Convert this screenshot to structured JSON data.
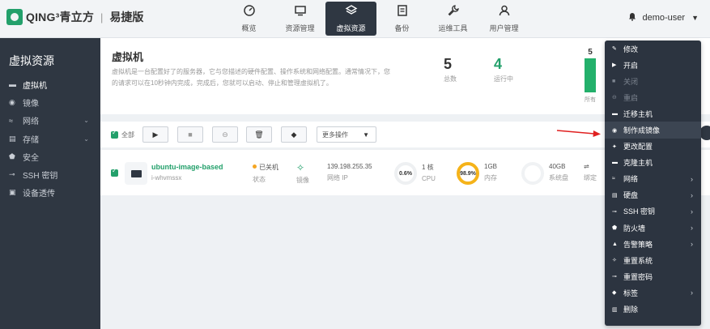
{
  "app": {
    "brand": "QING³青立方",
    "separator": "|",
    "edition": "易捷版"
  },
  "nav": [
    {
      "label": "概览",
      "icon": "dashboard-icon"
    },
    {
      "label": "资源管理",
      "icon": "monitor-icon"
    },
    {
      "label": "虚拟资源",
      "icon": "layers-icon",
      "active": true
    },
    {
      "label": "备份",
      "icon": "backup-icon"
    },
    {
      "label": "运维工具",
      "icon": "wrench-icon"
    },
    {
      "label": "用户管理",
      "icon": "users-icon"
    }
  ],
  "user": {
    "name": "demo-user"
  },
  "sidebar": {
    "title": "虚拟资源",
    "items": [
      {
        "label": "虚拟机",
        "icon": "monitor-icon",
        "active": true
      },
      {
        "label": "镜像",
        "icon": "disc-icon"
      },
      {
        "label": "网络",
        "icon": "wifi-icon",
        "expandable": true
      },
      {
        "label": "存储",
        "icon": "storage-icon",
        "expandable": true
      },
      {
        "label": "安全",
        "icon": "shield-icon"
      },
      {
        "label": "SSH 密钥",
        "icon": "key-icon"
      },
      {
        "label": "设备透传",
        "icon": "device-icon"
      }
    ]
  },
  "hero": {
    "title": "虚拟机",
    "description": "虚拟机是一台配置好了的服务器，它与您描述的硬件配置、操作系统和网络配置。通常情况下，您的请求可以在10秒钟内完成，完成后，您就可以启动、停止和管理虚拟机了。",
    "stats": [
      {
        "value": "5",
        "label": "总数"
      },
      {
        "value": "4",
        "label": "运行中"
      }
    ],
    "bar": {
      "value": "5",
      "label": "所有"
    }
  },
  "toolbar": {
    "select_all_label": "全部",
    "more_label": "更多操作"
  },
  "vm": {
    "name": "ubuntu-image-based",
    "id": "i-whvmssx",
    "status": "已关机",
    "status_label": "状态",
    "image_label": "镜像",
    "ip": "139.198.255.35",
    "ip_label": "网络 IP",
    "cpu_percent": "0.6%",
    "cpu_value": "1 核",
    "cpu_label": "CPU",
    "mem_percent": "98.9%",
    "mem_value": "1GB",
    "mem_label": "内存",
    "disk_value": "40GB",
    "disk_label": "系统盘",
    "extra_label": "绑定"
  },
  "context_menu": [
    {
      "label": "修改",
      "icon": "pencil-icon"
    },
    {
      "label": "开启",
      "icon": "play-icon"
    },
    {
      "label": "关闭",
      "icon": "stop-icon",
      "disabled": true
    },
    {
      "label": "重启",
      "icon": "restart-icon",
      "disabled": true
    },
    {
      "label": "迁移主机",
      "icon": "migrate-icon"
    },
    {
      "label": "制作成镜像",
      "icon": "image-icon",
      "highlighted": true
    },
    {
      "label": "更改配置",
      "icon": "config-icon"
    },
    {
      "label": "克隆主机",
      "icon": "clone-icon"
    },
    {
      "label": "网络",
      "icon": "wifi-icon",
      "submenu": true
    },
    {
      "label": "硬盘",
      "icon": "disk-icon",
      "submenu": true
    },
    {
      "label": "SSH 密钥",
      "icon": "key-icon",
      "submenu": true
    },
    {
      "label": "防火墙",
      "icon": "shield-icon",
      "submenu": true
    },
    {
      "label": "告警策略",
      "icon": "bell-icon",
      "submenu": true
    },
    {
      "label": "重置系统",
      "icon": "wrench-icon"
    },
    {
      "label": "重置密码",
      "icon": "key-icon"
    },
    {
      "label": "标签",
      "icon": "tag-icon",
      "submenu": true
    },
    {
      "label": "删除",
      "icon": "trash-icon"
    }
  ],
  "colors": {
    "accent": "#23a06b",
    "dark": "#2f3742",
    "warning": "#f5a623",
    "pointer": "#e02020"
  }
}
